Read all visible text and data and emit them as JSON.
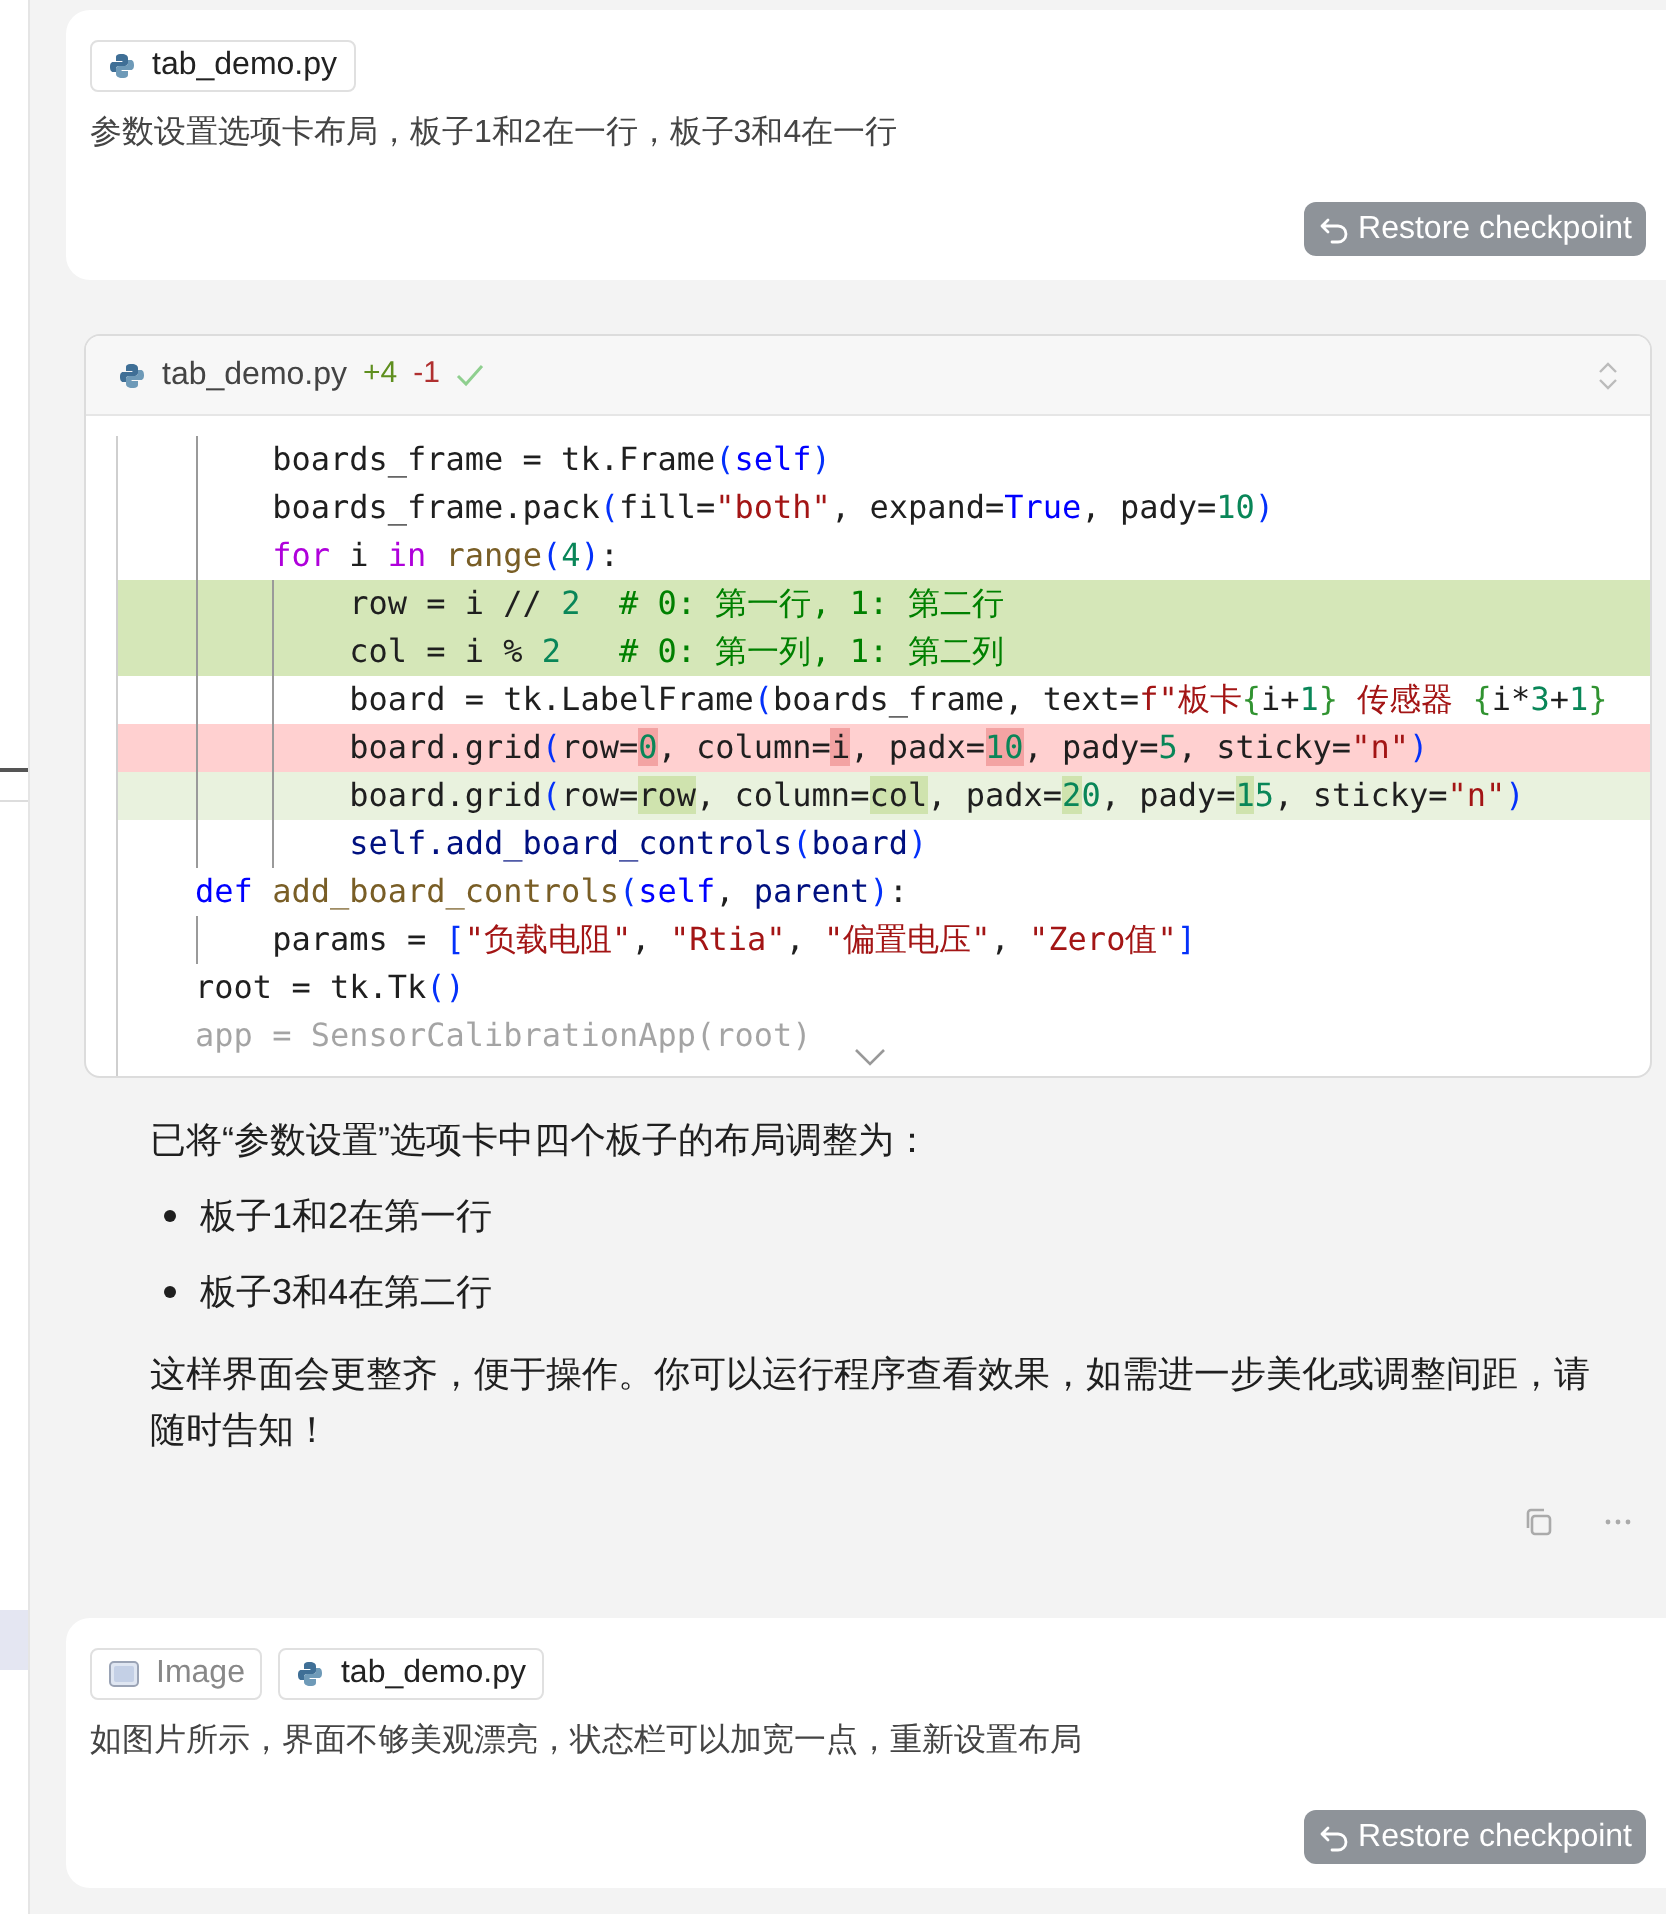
{
  "messages": [
    {
      "kind": "user",
      "attachments": [
        {
          "kind": "file",
          "label": "tab_demo.py"
        }
      ],
      "text": "参数设置选项卡布局，板子1和2在一行，板子3和4在一行",
      "restore_label": "Restore checkpoint"
    },
    {
      "kind": "assistant",
      "code_edit": {
        "file": "tab_demo.py",
        "added": "+4",
        "removed": "-1",
        "applied": true,
        "lines": [
          {
            "kind": "context",
            "tokens": [
              {
                "kind": "plain",
                "text": "        boards_frame = tk.Frame"
              },
              {
                "kind": "bracket",
                "text": "("
              },
              {
                "kind": "storage",
                "text": "self"
              },
              {
                "kind": "bracket",
                "text": ")"
              }
            ]
          },
          {
            "kind": "context",
            "tokens": [
              {
                "kind": "plain",
                "text": "        boards_frame.pack"
              },
              {
                "kind": "bracket",
                "text": "("
              },
              {
                "kind": "plain",
                "text": "fill="
              },
              {
                "kind": "string",
                "text": "\"both\""
              },
              {
                "kind": "plain",
                "text": ", expand="
              },
              {
                "kind": "storage",
                "text": "True"
              },
              {
                "kind": "plain",
                "text": ", pady="
              },
              {
                "kind": "number",
                "text": "10"
              },
              {
                "kind": "bracket",
                "text": ")"
              }
            ]
          },
          {
            "kind": "context",
            "tokens": [
              {
                "kind": "keyword",
                "text": "        for"
              },
              {
                "kind": "plain",
                "text": " i "
              },
              {
                "kind": "keyword",
                "text": "in "
              },
              {
                "kind": "function",
                "text": "range"
              },
              {
                "kind": "bracket",
                "text": "("
              },
              {
                "kind": "number",
                "text": "4"
              },
              {
                "kind": "bracket",
                "text": ")"
              },
              {
                "kind": "plain",
                "text": ":"
              }
            ]
          },
          {
            "kind": "added",
            "tokens": [
              {
                "kind": "plain",
                "text": "            row = i // "
              },
              {
                "kind": "number",
                "text": "2"
              },
              {
                "kind": "comment",
                "text": "  # 0: 第一行, 1: 第二行"
              }
            ]
          },
          {
            "kind": "added",
            "tokens": [
              {
                "kind": "plain",
                "text": "            col = i % "
              },
              {
                "kind": "number",
                "text": "2"
              },
              {
                "kind": "comment",
                "text": "   # 0: 第一列, 1: 第二列"
              }
            ]
          },
          {
            "kind": "context",
            "tokens": [
              {
                "kind": "plain",
                "text": "            board = tk.LabelFrame"
              },
              {
                "kind": "bracket",
                "text": "("
              },
              {
                "kind": "plain",
                "text": "boards_frame, text="
              },
              {
                "kind": "string",
                "text": "f\"板卡"
              },
              {
                "kind": "brace",
                "text": "{"
              },
              {
                "kind": "plain",
                "text": "i+"
              },
              {
                "kind": "number",
                "text": "1"
              },
              {
                "kind": "brace",
                "text": "}"
              },
              {
                "kind": "string",
                "text": " 传感器 "
              },
              {
                "kind": "brace",
                "text": "{"
              },
              {
                "kind": "plain",
                "text": "i*"
              },
              {
                "kind": "number",
                "text": "3"
              },
              {
                "kind": "plain",
                "text": "+"
              },
              {
                "kind": "number",
                "text": "1"
              },
              {
                "kind": "brace",
                "text": "}"
              }
            ]
          },
          {
            "kind": "removed",
            "tokens": [
              {
                "kind": "plain",
                "text": "            board.grid"
              },
              {
                "kind": "bracket",
                "text": "("
              },
              {
                "kind": "plain",
                "text": "row="
              },
              {
                "kind": "number",
                "text": "0",
                "changed": true
              },
              {
                "kind": "plain",
                "text": ", column="
              },
              {
                "kind": "plain",
                "text": "i",
                "changed": true
              },
              {
                "kind": "plain",
                "text": ", padx="
              },
              {
                "kind": "number",
                "text": "10",
                "changed": true
              },
              {
                "kind": "plain",
                "text": ", pady="
              },
              {
                "kind": "number",
                "text": "5"
              },
              {
                "kind": "plain",
                "text": ", sticky="
              },
              {
                "kind": "string",
                "text": "\"n\""
              },
              {
                "kind": "bracket",
                "text": ")"
              }
            ]
          },
          {
            "kind": "edited",
            "tokens": [
              {
                "kind": "plain",
                "text": "            board.grid"
              },
              {
                "kind": "bracket",
                "text": "("
              },
              {
                "kind": "plain",
                "text": "row="
              },
              {
                "kind": "plain",
                "text": "row",
                "changed": true
              },
              {
                "kind": "plain",
                "text": ", column="
              },
              {
                "kind": "plain",
                "text": "col",
                "changed": true
              },
              {
                "kind": "plain",
                "text": ", padx="
              },
              {
                "kind": "number",
                "text": "2",
                "changed": true
              },
              {
                "kind": "number",
                "text": "0"
              },
              {
                "kind": "plain",
                "text": ", pady="
              },
              {
                "kind": "number",
                "text": "1",
                "changed": true
              },
              {
                "kind": "number",
                "text": "5"
              },
              {
                "kind": "plain",
                "text": ", sticky="
              },
              {
                "kind": "string",
                "text": "\"n\""
              },
              {
                "kind": "bracket",
                "text": ")"
              }
            ]
          },
          {
            "kind": "context",
            "tokens": [
              {
                "kind": "member",
                "text": "            self.add_board_controls"
              },
              {
                "kind": "bracket",
                "text": "("
              },
              {
                "kind": "member",
                "text": "board"
              },
              {
                "kind": "bracket",
                "text": ")"
              }
            ]
          },
          {
            "kind": "context",
            "tokens": [
              {
                "kind": "storage",
                "text": "    def "
              },
              {
                "kind": "function",
                "text": "add_board_controls"
              },
              {
                "kind": "bracket",
                "text": "("
              },
              {
                "kind": "storage",
                "text": "self"
              },
              {
                "kind": "plain",
                "text": ", "
              },
              {
                "kind": "member",
                "text": "parent"
              },
              {
                "kind": "bracket",
                "text": ")"
              },
              {
                "kind": "plain",
                "text": ":"
              }
            ]
          },
          {
            "kind": "context",
            "tokens": [
              {
                "kind": "plain",
                "text": "        params = "
              },
              {
                "kind": "bracket",
                "text": "["
              },
              {
                "kind": "string",
                "text": "\"负载电阻\""
              },
              {
                "kind": "plain",
                "text": ", "
              },
              {
                "kind": "string",
                "text": "\"Rtia\""
              },
              {
                "kind": "plain",
                "text": ", "
              },
              {
                "kind": "string",
                "text": "\"偏置电压\""
              },
              {
                "kind": "plain",
                "text": ", "
              },
              {
                "kind": "string",
                "text": "\"Zero值\""
              },
              {
                "kind": "bracket",
                "text": "]"
              }
            ]
          },
          {
            "kind": "context",
            "tokens": [
              {
                "kind": "plain",
                "text": "    root = tk.Tk"
              },
              {
                "kind": "bracket",
                "text": "()"
              }
            ]
          },
          {
            "kind": "context",
            "faded": true,
            "tokens": [
              {
                "kind": "plain",
                "text": "    app = SensorCalibrationApp(root)"
              }
            ]
          }
        ]
      },
      "intro": "已将“参数设置”选项卡中四个板子的布局调整为：",
      "bullets": [
        "板子1和2在第一行",
        "板子3和4在第二行"
      ],
      "closing": "这样界面会更整齐，便于操作。你可以运行程序查看效果，如需进一步美化或调整间距，请随时告知！"
    },
    {
      "kind": "user",
      "attachments": [
        {
          "kind": "image",
          "label": "Image"
        },
        {
          "kind": "file",
          "label": "tab_demo.py"
        }
      ],
      "text": "如图片所示，界面不够美观漂亮，状态栏可以加宽一点，重新设置布局",
      "restore_label": "Restore checkpoint"
    }
  ]
}
